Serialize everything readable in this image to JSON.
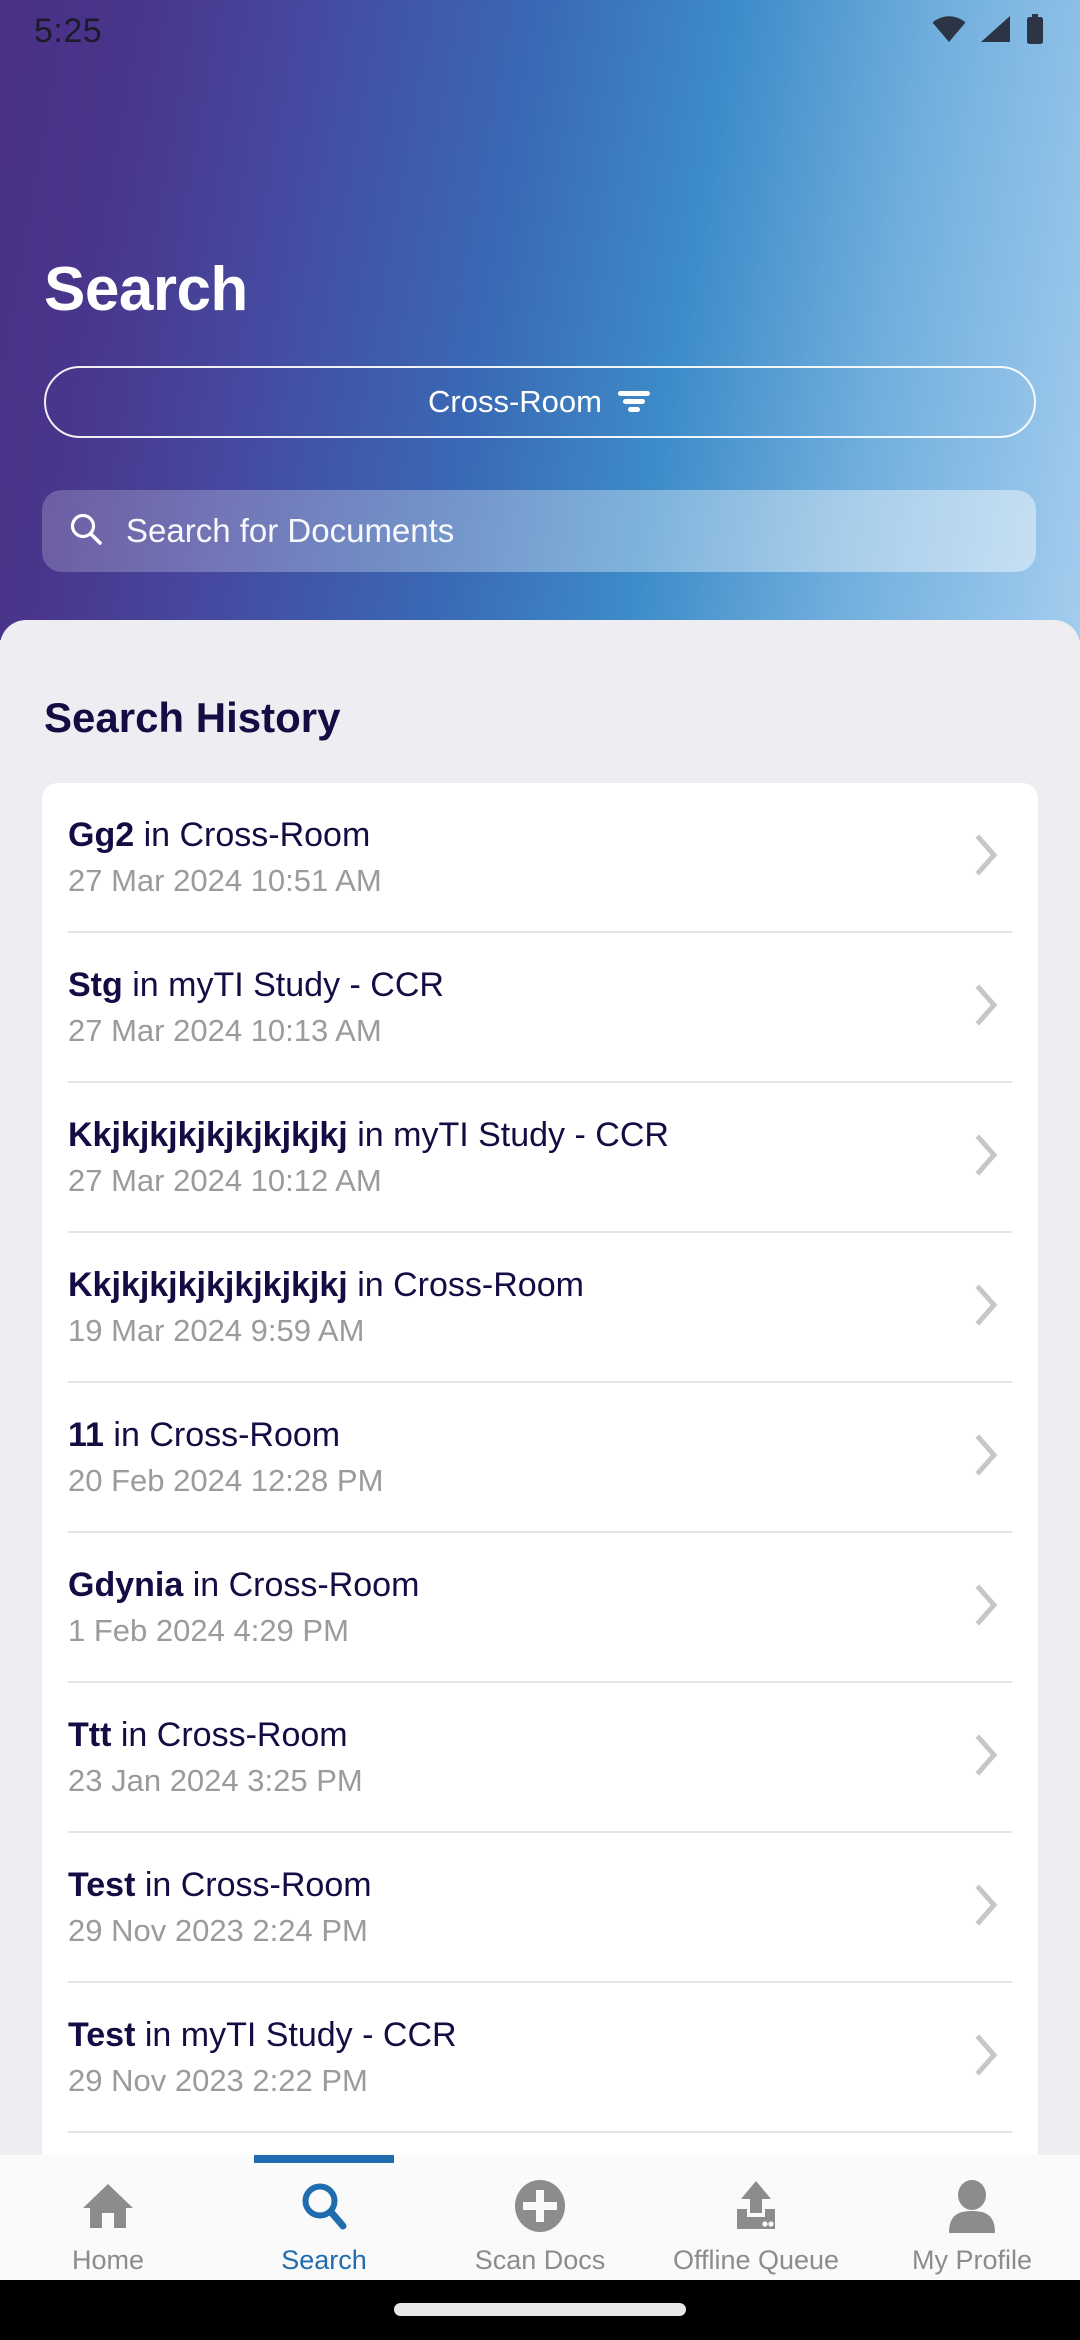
{
  "status_bar": {
    "time": "5:25",
    "icons": [
      "wifi-icon",
      "cellular-signal-icon",
      "battery-icon"
    ]
  },
  "header": {
    "title": "Search",
    "room_selector": {
      "label": "Cross-Room",
      "icon": "filter-icon"
    },
    "search_field": {
      "placeholder": "Search for Documents",
      "value": "",
      "icon": "search-icon"
    },
    "gradient_start": "#4a2f86",
    "gradient_end": "#a4cdee"
  },
  "content": {
    "section_title": "Search History",
    "connector": " in ",
    "chevron_icon": "chevron-right-icon",
    "history": [
      {
        "term": "Gg2",
        "room": "Cross-Room",
        "timestamp": "27 Mar 2024 10:51 AM"
      },
      {
        "term": "Stg",
        "room": "myTI Study - CCR",
        "timestamp": "27 Mar 2024 10:13 AM"
      },
      {
        "term": "Kkjkjkjkjkjkjkjkjkj",
        "room": "myTI Study - CCR",
        "timestamp": "27 Mar 2024 10:12 AM"
      },
      {
        "term": "Kkjkjkjkjkjkjkjkjkj",
        "room": "Cross-Room",
        "timestamp": "19 Mar 2024 9:59 AM"
      },
      {
        "term": "11",
        "room": "Cross-Room",
        "timestamp": "20 Feb 2024 12:28 PM"
      },
      {
        "term": "Gdynia",
        "room": "Cross-Room",
        "timestamp": "1 Feb 2024 4:29 PM"
      },
      {
        "term": "Ttt",
        "room": "Cross-Room",
        "timestamp": "23 Jan 2024 3:25 PM"
      },
      {
        "term": "Test",
        "room": "Cross-Room",
        "timestamp": "29 Nov 2023 2:24 PM"
      },
      {
        "term": "Test",
        "room": "myTI Study - CCR",
        "timestamp": "29 Nov 2023 2:22 PM"
      }
    ]
  },
  "bottom_nav": {
    "active_index": 1,
    "active_color": "#1f6cae",
    "inactive_color": "#8c8c8c",
    "items": [
      {
        "label": "Home",
        "icon": "home-icon"
      },
      {
        "label": "Search",
        "icon": "search-icon"
      },
      {
        "label": "Scan Docs",
        "icon": "plus-circle-icon"
      },
      {
        "label": "Offline Queue",
        "icon": "upload-tray-icon"
      },
      {
        "label": "My Profile",
        "icon": "person-icon"
      }
    ]
  }
}
